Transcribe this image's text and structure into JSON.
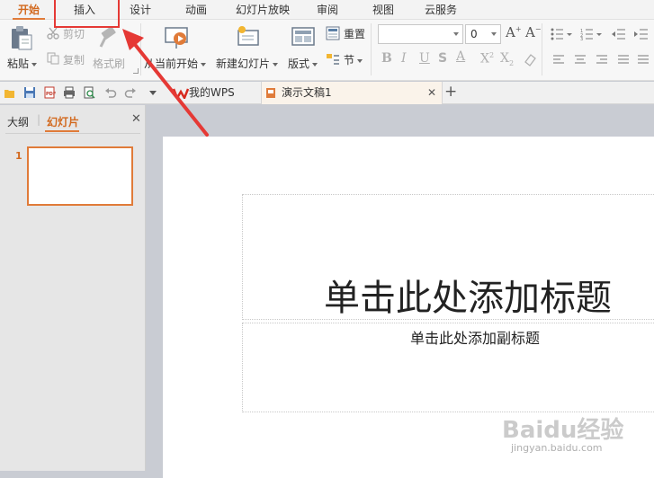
{
  "menu_tabs": [
    {
      "label": "开始",
      "active": true
    },
    {
      "label": "插入",
      "active": false
    },
    {
      "label": "设计",
      "active": false
    },
    {
      "label": "动画",
      "active": false
    },
    {
      "label": "幻灯片放映",
      "active": false
    },
    {
      "label": "审阅",
      "active": false
    },
    {
      "label": "视图",
      "active": false
    },
    {
      "label": "云服务",
      "active": false
    }
  ],
  "ribbon": {
    "paste": "粘贴",
    "cut": "剪切",
    "copy": "复制",
    "format_painter": "格式刷",
    "from_current": "从当前开始",
    "new_slide": "新建幻灯片",
    "layout": "版式",
    "reset": "重置",
    "section": "节",
    "font_size": "0"
  },
  "doc_tabs": [
    {
      "label": "我的WPS"
    },
    {
      "label": "演示文稿1"
    }
  ],
  "left_panel": {
    "outline_tab": "大纲",
    "slides_tab": "幻灯片",
    "slide_number": "1"
  },
  "slide": {
    "title_placeholder": "单击此处添加标题",
    "subtitle_placeholder": "单击此处添加副标题"
  },
  "watermark": {
    "text": "Baidu经验",
    "url": "jingyan.baidu.com"
  },
  "colors": {
    "accent": "#e07b39",
    "annotation": "#e53935"
  }
}
